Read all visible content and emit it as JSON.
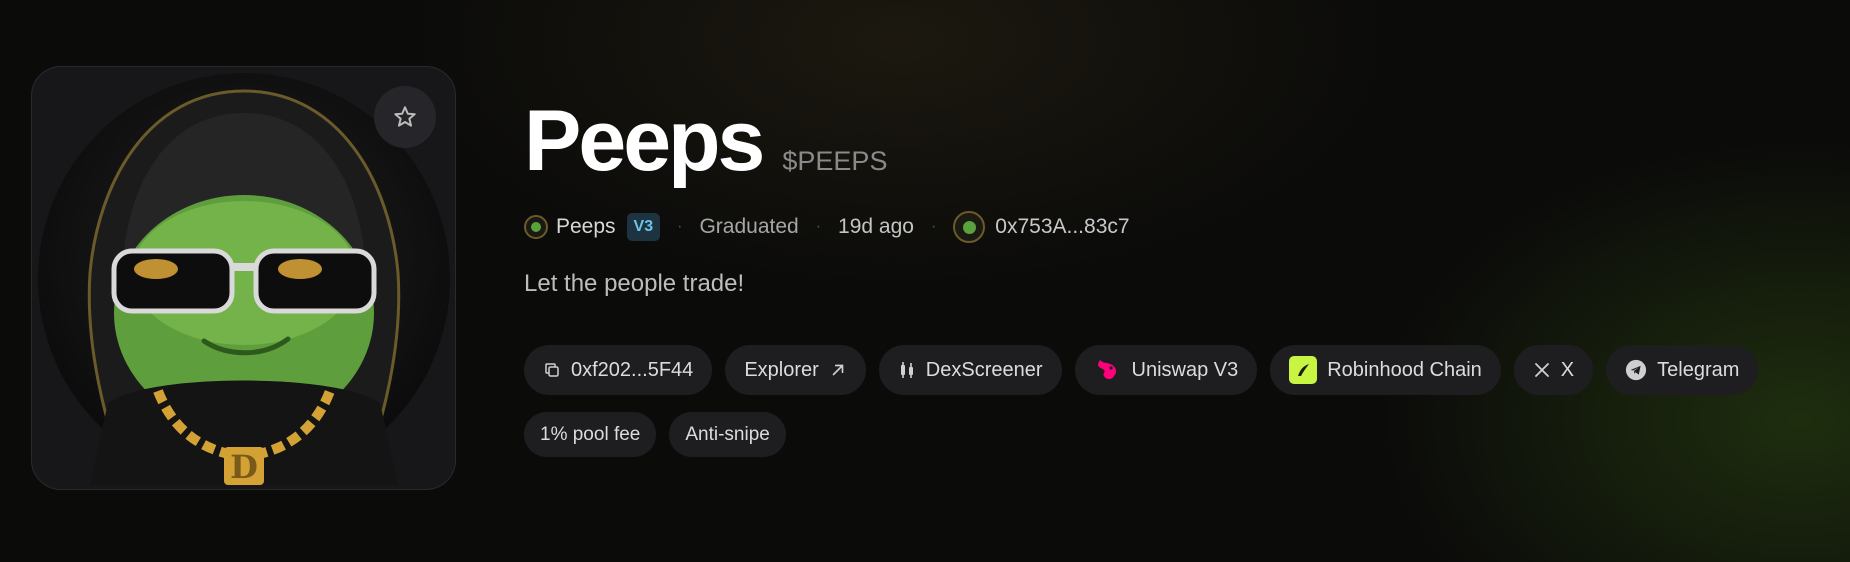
{
  "token": {
    "name": "Peeps",
    "ticker": "$PEEPS",
    "description": "Let the people trade!"
  },
  "meta": {
    "creator_name": "Peeps",
    "version_badge": "V3",
    "status": "Graduated",
    "age": "19d ago",
    "deployer_address": "0x753A...83c7"
  },
  "links": {
    "contract": "0xf202...5F44",
    "explorer": "Explorer",
    "dexscreener": "DexScreener",
    "uniswap": "Uniswap V3",
    "chain": "Robinhood Chain",
    "x": "X",
    "telegram": "Telegram"
  },
  "tags": {
    "pool_fee": "1% pool fee",
    "anti_snipe": "Anti-snipe"
  },
  "icons": {
    "favorite": "star-icon",
    "copy": "copy-icon",
    "external": "arrow-up-right-icon",
    "dexscreener": "dexscreener-icon",
    "uniswap": "uniswap-icon",
    "robinhood": "robinhood-icon",
    "x": "x-logo-icon",
    "telegram": "telegram-icon"
  },
  "colors": {
    "version_badge_text": "#6fc2ea",
    "robinhood_badge": "#c8f542",
    "uniswap_pink": "#ff007a"
  }
}
